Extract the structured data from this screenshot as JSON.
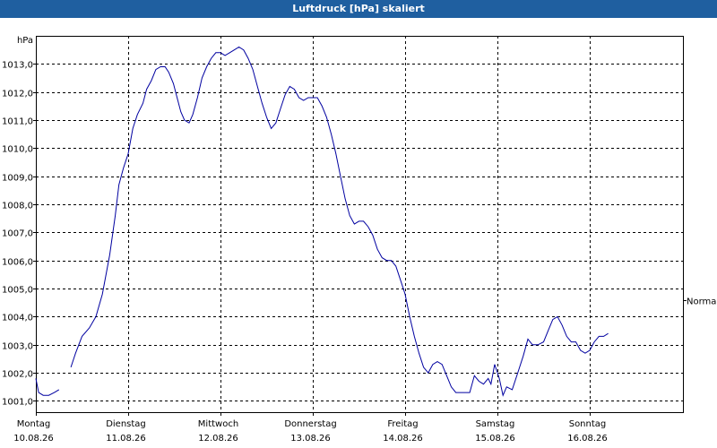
{
  "window": {
    "title": "Luftdruck [hPa] skaliert"
  },
  "chart_data": {
    "type": "line",
    "title": "Luftdruck [hPa] skaliert",
    "ylabel": "hPa",
    "xlabel": "",
    "ylim": [
      1000.6,
      1014.0
    ],
    "yticks": [
      1001.0,
      1002.0,
      1003.0,
      1004.0,
      1005.0,
      1006.0,
      1007.0,
      1008.0,
      1009.0,
      1010.0,
      1011.0,
      1012.0,
      1013.0
    ],
    "ytick_labels": [
      "1001,0",
      "1002,0",
      "1003,0",
      "1004,0",
      "1005,0",
      "1006,0",
      "1007,0",
      "1008,0",
      "1009,0",
      "1010,0",
      "1011,0",
      "1012,0",
      "1013,0"
    ],
    "xlim": [
      0,
      7
    ],
    "x_ticks": [
      {
        "x": 0,
        "day": "Montag",
        "date": "10.08.26"
      },
      {
        "x": 1,
        "day": "Dienstag",
        "date": "11.08.26"
      },
      {
        "x": 2,
        "day": "Mittwoch",
        "date": "12.08.26"
      },
      {
        "x": 3,
        "day": "Donnerstag",
        "date": "13.08.26"
      },
      {
        "x": 4,
        "day": "Freitag",
        "date": "14.08.26"
      },
      {
        "x": 5,
        "day": "Samstag",
        "date": "15.08.26"
      },
      {
        "x": 6,
        "day": "Sonntag",
        "date": "16.08.26"
      }
    ],
    "right_label": {
      "text": "Normal",
      "y": 1004.6
    },
    "grid": true,
    "line_color": "#0000a0",
    "series": [
      {
        "segments": [
          [
            [
              0.0,
              1001.8
            ],
            [
              0.03,
              1001.3
            ],
            [
              0.08,
              1001.2
            ],
            [
              0.14,
              1001.2
            ],
            [
              0.2,
              1001.3
            ],
            [
              0.25,
              1001.4
            ]
          ],
          [
            [
              0.38,
              1002.2
            ],
            [
              0.43,
              1002.7
            ],
            [
              0.5,
              1003.3
            ],
            [
              0.58,
              1003.6
            ],
            [
              0.65,
              1004.0
            ],
            [
              0.72,
              1004.8
            ],
            [
              0.8,
              1006.2
            ],
            [
              0.86,
              1007.6
            ],
            [
              0.9,
              1008.7
            ],
            [
              0.95,
              1009.3
            ],
            [
              1.0,
              1009.8
            ],
            [
              1.05,
              1010.7
            ],
            [
              1.1,
              1011.2
            ],
            [
              1.16,
              1011.6
            ],
            [
              1.2,
              1012.1
            ],
            [
              1.25,
              1012.4
            ],
            [
              1.3,
              1012.8
            ],
            [
              1.35,
              1012.9
            ],
            [
              1.4,
              1012.9
            ],
            [
              1.44,
              1012.7
            ],
            [
              1.49,
              1012.3
            ],
            [
              1.53,
              1011.8
            ],
            [
              1.57,
              1011.3
            ],
            [
              1.61,
              1011.0
            ],
            [
              1.66,
              1010.9
            ],
            [
              1.7,
              1011.2
            ],
            [
              1.75,
              1011.8
            ],
            [
              1.8,
              1012.5
            ],
            [
              1.85,
              1012.9
            ],
            [
              1.9,
              1013.2
            ],
            [
              1.95,
              1013.4
            ],
            [
              2.0,
              1013.4
            ],
            [
              2.05,
              1013.3
            ],
            [
              2.1,
              1013.4
            ],
            [
              2.15,
              1013.5
            ],
            [
              2.2,
              1013.6
            ],
            [
              2.25,
              1013.5
            ],
            [
              2.3,
              1013.2
            ],
            [
              2.35,
              1012.8
            ],
            [
              2.4,
              1012.2
            ],
            [
              2.45,
              1011.6
            ],
            [
              2.5,
              1011.1
            ],
            [
              2.55,
              1010.7
            ],
            [
              2.6,
              1010.9
            ],
            [
              2.65,
              1011.4
            ],
            [
              2.7,
              1011.9
            ],
            [
              2.75,
              1012.2
            ],
            [
              2.8,
              1012.1
            ],
            [
              2.85,
              1011.8
            ],
            [
              2.9,
              1011.7
            ],
            [
              2.95,
              1011.8
            ],
            [
              3.0,
              1011.8
            ],
            [
              3.05,
              1011.8
            ],
            [
              3.1,
              1011.5
            ],
            [
              3.15,
              1011.1
            ],
            [
              3.2,
              1010.5
            ],
            [
              3.25,
              1009.8
            ],
            [
              3.3,
              1009.0
            ],
            [
              3.35,
              1008.2
            ],
            [
              3.4,
              1007.6
            ],
            [
              3.45,
              1007.3
            ],
            [
              3.5,
              1007.4
            ],
            [
              3.55,
              1007.4
            ],
            [
              3.6,
              1007.2
            ],
            [
              3.65,
              1006.9
            ],
            [
              3.7,
              1006.4
            ],
            [
              3.75,
              1006.1
            ],
            [
              3.8,
              1006.0
            ],
            [
              3.85,
              1006.0
            ],
            [
              3.9,
              1005.8
            ],
            [
              3.95,
              1005.3
            ],
            [
              4.0,
              1004.8
            ],
            [
              4.05,
              1004.0
            ],
            [
              4.1,
              1003.3
            ],
            [
              4.15,
              1002.7
            ],
            [
              4.2,
              1002.2
            ],
            [
              4.25,
              1002.0
            ],
            [
              4.3,
              1002.3
            ],
            [
              4.35,
              1002.4
            ],
            [
              4.4,
              1002.3
            ],
            [
              4.45,
              1001.9
            ],
            [
              4.5,
              1001.5
            ],
            [
              4.55,
              1001.3
            ],
            [
              4.6,
              1001.3
            ],
            [
              4.65,
              1001.3
            ],
            [
              4.7,
              1001.3
            ],
            [
              4.75,
              1001.9
            ],
            [
              4.8,
              1001.7
            ],
            [
              4.85,
              1001.6
            ],
            [
              4.9,
              1001.8
            ],
            [
              4.93,
              1001.6
            ],
            [
              4.97,
              1002.3
            ],
            [
              5.02,
              1001.8
            ],
            [
              5.06,
              1001.2
            ],
            [
              5.1,
              1001.5
            ],
            [
              5.16,
              1001.4
            ],
            [
              5.22,
              1002.0
            ],
            [
              5.28,
              1002.6
            ],
            [
              5.33,
              1003.2
            ],
            [
              5.38,
              1003.0
            ],
            [
              5.44,
              1003.0
            ],
            [
              5.5,
              1003.1
            ],
            [
              5.55,
              1003.5
            ],
            [
              5.6,
              1003.9
            ],
            [
              5.65,
              1004.0
            ],
            [
              5.7,
              1003.7
            ],
            [
              5.75,
              1003.3
            ],
            [
              5.8,
              1003.1
            ],
            [
              5.85,
              1003.1
            ],
            [
              5.9,
              1002.8
            ],
            [
              5.95,
              1002.7
            ],
            [
              6.0,
              1002.8
            ],
            [
              6.05,
              1003.1
            ],
            [
              6.1,
              1003.3
            ],
            [
              6.15,
              1003.3
            ],
            [
              6.2,
              1003.4
            ]
          ]
        ]
      }
    ]
  }
}
